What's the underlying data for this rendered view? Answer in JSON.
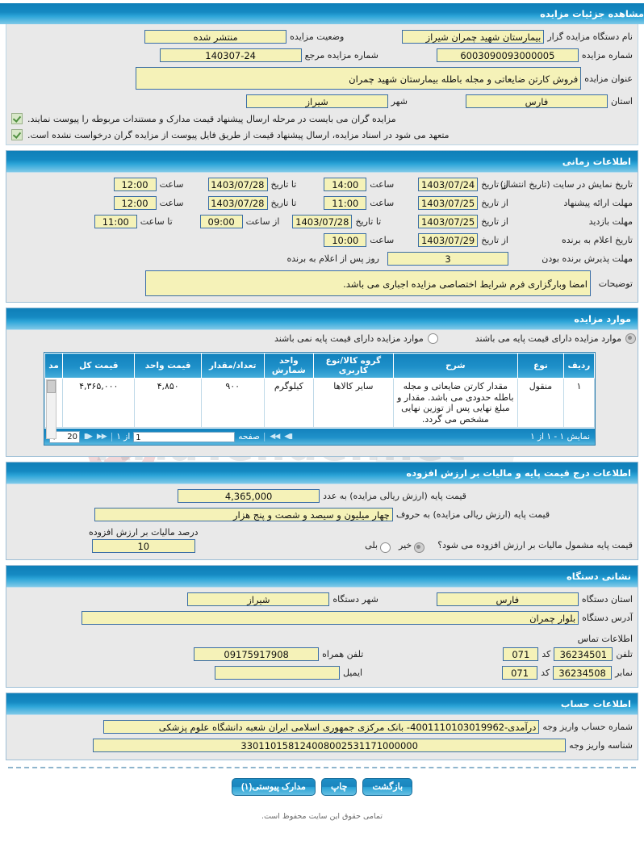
{
  "header": {
    "title": "مشاهده جزئیات مزایده"
  },
  "overview": {
    "org_label": "نام دستگاه مزایده گزار",
    "org_value": "بیمارستان شهید چمران شیراز",
    "status_label": "وضعیت مزایده",
    "status_value": "منتشر شده",
    "auction_no_label": "شماره مزایده",
    "auction_no_value": "6003090093000005",
    "ref_no_label": "شماره مزایده مرجع",
    "ref_no_value": "140307-24",
    "title_label": "عنوان مزایده",
    "title_value": "فروش کارتن ضایعاتی و مجله باطله بیمارستان شهید چمران",
    "province_label": "استان",
    "province_value": "فارس",
    "city_label": "شهر",
    "city_value": "شیراز",
    "notes": [
      "مزایده گران می بایست در مرحله ارسال پیشنهاد قیمت مدارک و مستندات مربوطه را پیوست نمایند.",
      "متعهد می شود در اسناد مزایده، ارسال پیشنهاد قیمت از طریق فایل پیوست از مزایده گران درخواست نشده است."
    ]
  },
  "timing": {
    "section_title": "اطلاعات زمانی",
    "from_date_label": "از تاریخ",
    "to_date_label": "تا تاریخ",
    "hour_label": "ساعت",
    "from_hour_label": "از ساعت",
    "to_hour_label": "تا ساعت",
    "rows": [
      {
        "label": "تاریخ نمایش در سایت (تاریخ انتشار)",
        "from_date": "1403/07/24",
        "from_time": "14:00",
        "to_date": "1403/07/28",
        "to_time": "12:00"
      },
      {
        "label": "مهلت ارائه پیشنهاد",
        "from_date": "1403/07/25",
        "from_time": "11:00",
        "to_date": "1403/07/28",
        "to_time": "12:00"
      },
      {
        "label": "مهلت بازدید",
        "from_date": "1403/07/25",
        "to_date": "1403/07/28",
        "from_time": "09:00",
        "to_time": "11:00"
      }
    ],
    "winner": {
      "label": "تاریخ اعلام به برنده",
      "from_date_label": "از تاریخ",
      "from_date": "1403/07/29",
      "hour_label": "ساعت",
      "time": "10:00"
    },
    "accept": {
      "label": "مهلت پذیرش برنده بودن",
      "value": "3",
      "suffix": "روز پس از اعلام به برنده"
    },
    "description_label": "توضیحات",
    "description_value": "امضا وبارگزاری فرم شرایط اختصاصی مزایده اجباری می باشد."
  },
  "items": {
    "section_title": "موارد مزایده",
    "radio_with_base": "موارد مزایده دارای قیمت پایه می باشند",
    "radio_without_base": "موارد مزایده دارای قیمت پایه نمی باشند",
    "columns": [
      "ردیف",
      "نوع",
      "شرح",
      "گروه کالا/نوع کاربری",
      "واحد شمارش",
      "تعداد/مقدار",
      "قیمت واحد",
      "قیمت کل",
      "مد"
    ],
    "rows": [
      {
        "index": "۱",
        "type": "منقول",
        "description": "مقدار کارتن ضایعاتی و مجله باطله حدودی می باشد. مقدار و مبلغ نهایی پس از توزین نهایی مشخص می گردد.",
        "group": "سایر کالاها",
        "unit": "کیلوگرم",
        "quantity": "۹۰۰",
        "unit_price": "۴,۸۵۰",
        "total_price": "۴,۳۶۵,۰۰۰"
      }
    ],
    "pager": {
      "showing": "نمایش ۱ - ۱ از ۱",
      "page_label": "صفحه",
      "page_value": "1",
      "of_label": "از ۱",
      "page_size": "20",
      "first_icon": "first-page-icon",
      "prev_icon": "prev-page-icon",
      "next_icon": "next-page-icon",
      "last_icon": "last-page-icon"
    }
  },
  "pricing": {
    "section_title": "اطلاعات درج قیمت پایه و مالیات بر ارزش افزوده",
    "base_number_label": "قیمت پایه (ارزش ریالی مزایده) به عدد",
    "base_number_value": "4,365,000",
    "base_words_label": "قیمت پایه (ارزش ریالی مزایده) به حروف",
    "base_words_value": "چهار میلیون و سیصد و شصت و پنج هزار",
    "vat_question": "قیمت پایه مشمول مالیات بر ارزش افزوده می شود؟",
    "vat_yes": "بلی",
    "vat_no": "خیر",
    "vat_selected": "خیر",
    "vat_percent_label": "درصد مالیات بر ارزش افزوده",
    "vat_percent_value": "10"
  },
  "address": {
    "section_title": "نشانی دستگاه",
    "province_label": "استان دستگاه",
    "province_value": "فارس",
    "city_label": "شهر دستگاه",
    "city_value": "شیراز",
    "address_label": "آدرس دستگاه",
    "address_value": "بلوار چمران",
    "contact_title": "اطلاعات تماس",
    "phone_label": "تلفن",
    "phone_value": "36234501",
    "phone_code_label": "کد",
    "phone_code_value": "071",
    "mobile_label": "تلفن همراه",
    "mobile_value": "09175917908",
    "fax_label": "نمابر",
    "fax_value": "36234508",
    "fax_code_label": "کد",
    "fax_code_value": "071",
    "email_label": "ایمیل",
    "email_value": ""
  },
  "account": {
    "section_title": "اطلاعات حساب",
    "account_no_label": "شماره حساب واریز وجه",
    "account_no_value": "درآمدی-4001110103019962- بانک مرکزی جمهوری اسلامی ایران شعبه دانشگاه علوم پزشکی",
    "account_id_label": "شناسه واریز وجه",
    "account_id_value": "330110158124008002531171000000"
  },
  "actions": {
    "attachments": "مدارک پیوستی(۱)",
    "print": "چاپ",
    "back": "بازگشت"
  },
  "footer": {
    "text": "تمامی حقوق این سایت محفوظ است."
  },
  "watermark": {
    "brand": "AriaTender.net"
  },
  "colors": {
    "header_blue": "#1589c2",
    "field_yellow": "#f5f2b8",
    "field_border": "#3b6ea5",
    "panel_gray": "#e9e9e9"
  }
}
